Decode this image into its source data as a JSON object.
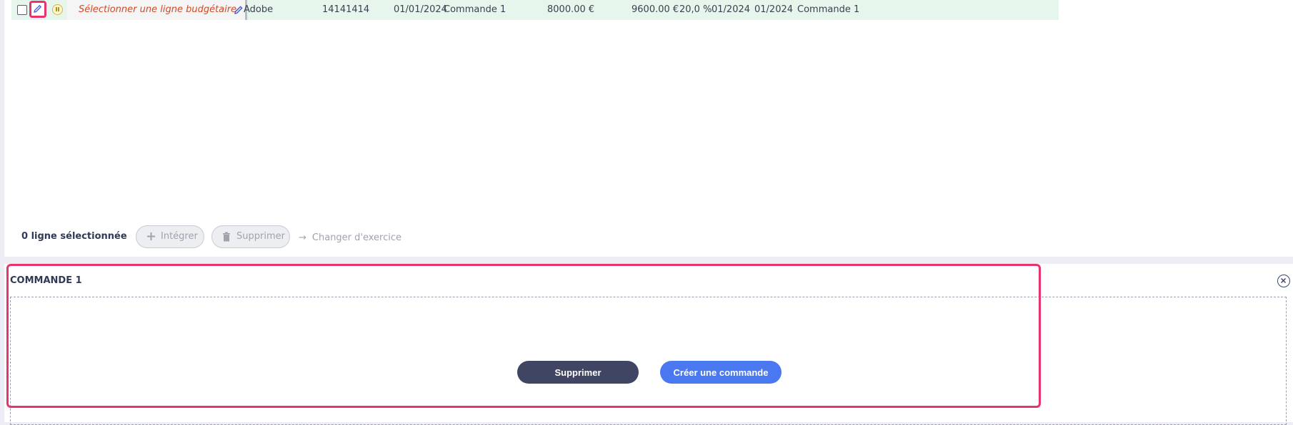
{
  "row": {
    "budget_placeholder": "Sélectionner une ligne budgétaire",
    "supplier": "Adobe",
    "reference": "14141414",
    "date": "01/01/2024",
    "order_name": "Commande 1",
    "amount_ht": "8000.00 €",
    "amount_ttc": "9600.00 €",
    "vat": "20,0 %",
    "period_start": "01/2024",
    "period_end": "01/2024",
    "order_label": "Commande 1"
  },
  "footer": {
    "selection_count": "0 ligne sélectionnée",
    "integrate_label": "Intégrer",
    "delete_label": "Supprimer",
    "change_year_label": "Changer d'exercice"
  },
  "detail": {
    "title": "COMMANDE 1",
    "delete_button": "Supprimer",
    "create_button": "Créer une commande"
  },
  "colors": {
    "highlight": "#e8336e",
    "row_bg": "#e6f6ec",
    "primary": "#4a78f0",
    "dark_button": "#3f4562"
  }
}
